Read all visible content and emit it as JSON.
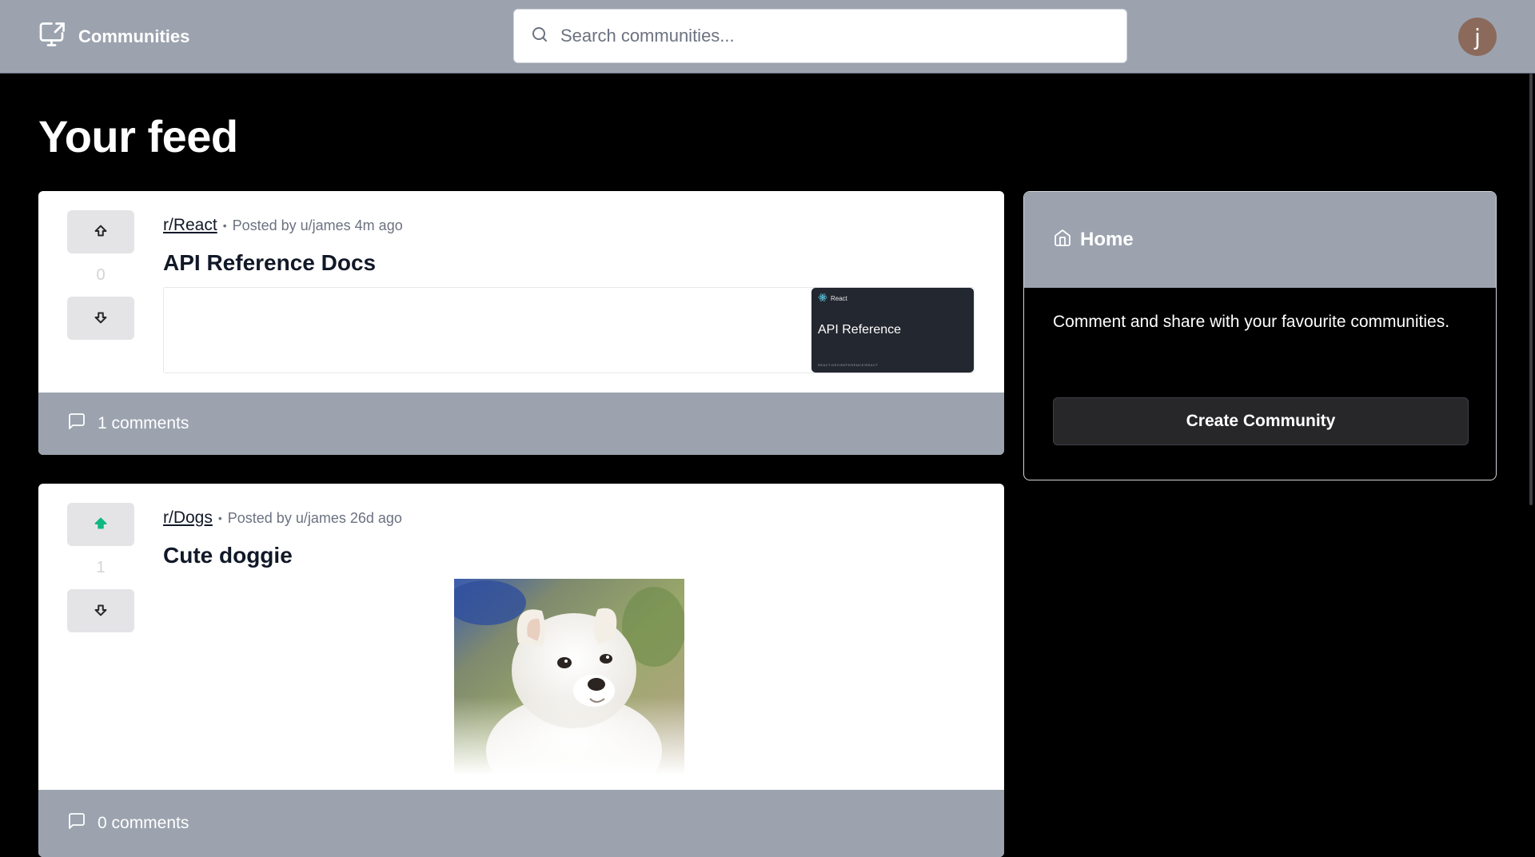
{
  "navbar": {
    "brand_label": "Communities",
    "search_placeholder": "Search communities...",
    "avatar_initial": "j"
  },
  "page": {
    "title": "Your feed"
  },
  "posts": [
    {
      "subreddit": "r/React",
      "posted_by": "Posted by u/james 4m ago",
      "title": "API Reference Docs",
      "votes": "0",
      "user_vote": "none",
      "comments": "1 comments",
      "preview": {
        "logo_text": "React",
        "heading": "API Reference",
        "url": "REACT.DEV/REFERENCE/REACT"
      }
    },
    {
      "subreddit": "r/Dogs",
      "posted_by": "Posted by u/james 26d ago",
      "title": "Cute doggie",
      "votes": "1",
      "user_vote": "up",
      "comments": "0 comments"
    }
  ],
  "sidebar": {
    "heading": "Home",
    "description": "Comment and share with your favourite communities.",
    "create_button": "Create Community"
  },
  "colors": {
    "navbar_bg": "#9ca3af",
    "upvote_active": "#10b981",
    "page_bg": "#000000"
  }
}
